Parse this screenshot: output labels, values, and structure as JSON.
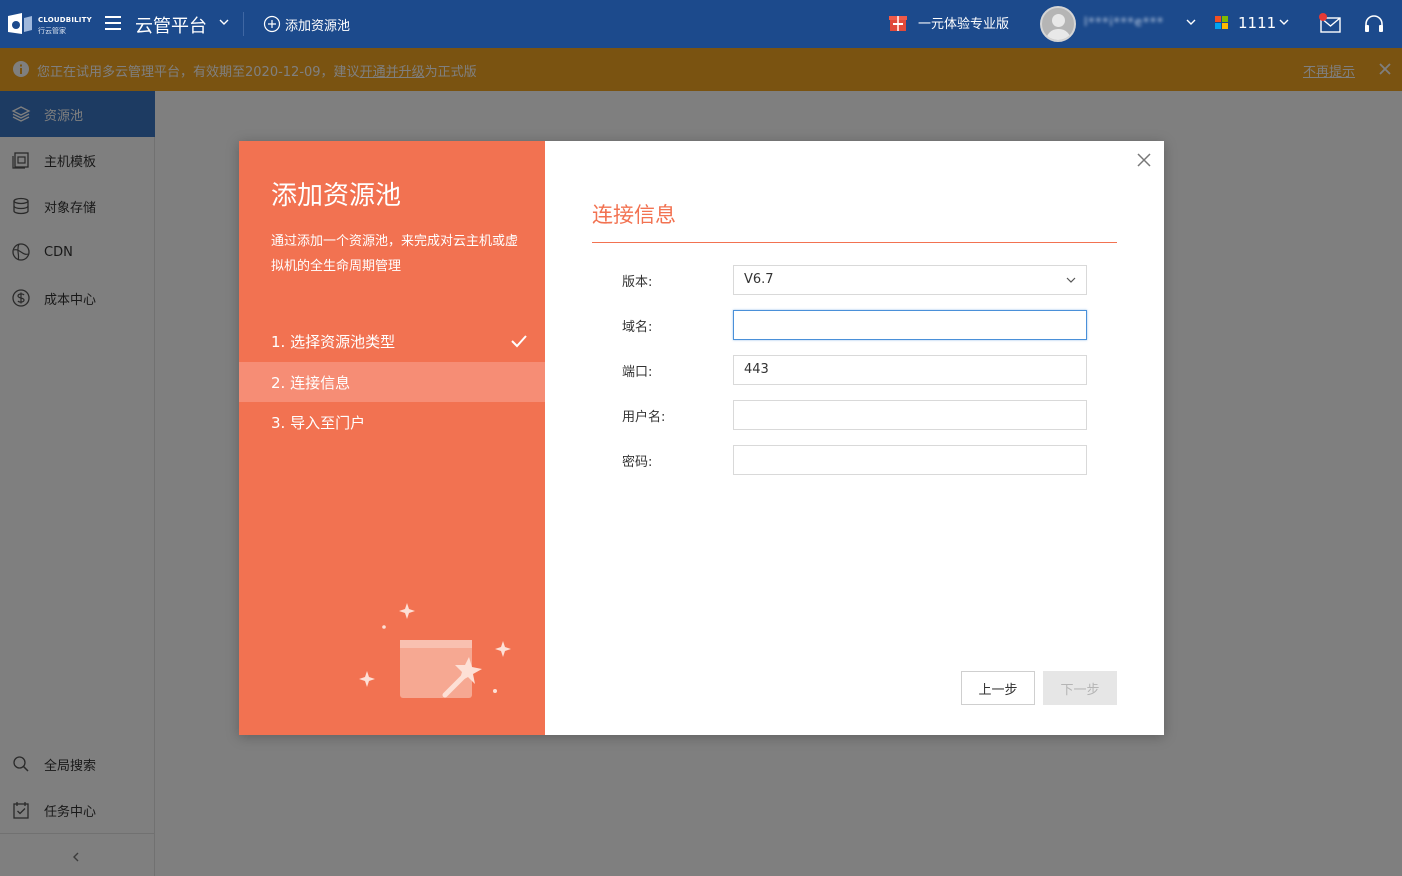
{
  "topbar": {
    "brand_text": "CLOUDBILITY",
    "brand_cn": "行云管家",
    "app_title": "云管平台",
    "add_pool_label": "添加资源池",
    "promo_label": "一元体验专业版",
    "username": "l***i***e***",
    "org_name": "1111",
    "colors": {
      "background": "#1c4a8c"
    }
  },
  "notice": {
    "message_prefix": "您正在试用多云管理平台，有效期至2020-12-09，建议",
    "message_link": "开通并升级",
    "message_suffix": "为正式版",
    "dismiss_label": "不再提示",
    "colors": {
      "background": "#f5a623"
    }
  },
  "sidebar": {
    "items": [
      {
        "label": "资源池",
        "icon": "layers-icon",
        "active": true
      },
      {
        "label": "主机模板",
        "icon": "template-icon",
        "active": false
      },
      {
        "label": "对象存储",
        "icon": "storage-icon",
        "active": false
      },
      {
        "label": "CDN",
        "icon": "globe-icon",
        "active": false
      },
      {
        "label": "成本中心",
        "icon": "dollar-icon",
        "active": false
      },
      {
        "label": "全局搜索",
        "icon": "search-icon",
        "active": false
      },
      {
        "label": "任务中心",
        "icon": "task-icon",
        "active": false
      }
    ],
    "colors": {
      "active": "#3a76c4"
    }
  },
  "modal": {
    "title": "添加资源池",
    "description": "通过添加一个资源池，来完成对云主机或虚拟机的全生命周期管理",
    "steps": [
      {
        "label": "1. 选择资源池类型",
        "state": "done"
      },
      {
        "label": "2. 连接信息",
        "state": "active"
      },
      {
        "label": "3. 导入至门户",
        "state": "pending"
      }
    ],
    "section_title": "连接信息",
    "form": {
      "version": {
        "label": "版本:",
        "value": "V6.7"
      },
      "domain": {
        "label": "域名:",
        "value": "",
        "focused": true
      },
      "port": {
        "label": "端口:",
        "value": "443"
      },
      "username": {
        "label": "用户名:",
        "value": ""
      },
      "password": {
        "label": "密码:",
        "value": ""
      }
    },
    "buttons": {
      "prev": "上一步",
      "next": "下一步"
    },
    "colors": {
      "accent": "#f27251",
      "active_step": "#f68d75"
    }
  }
}
